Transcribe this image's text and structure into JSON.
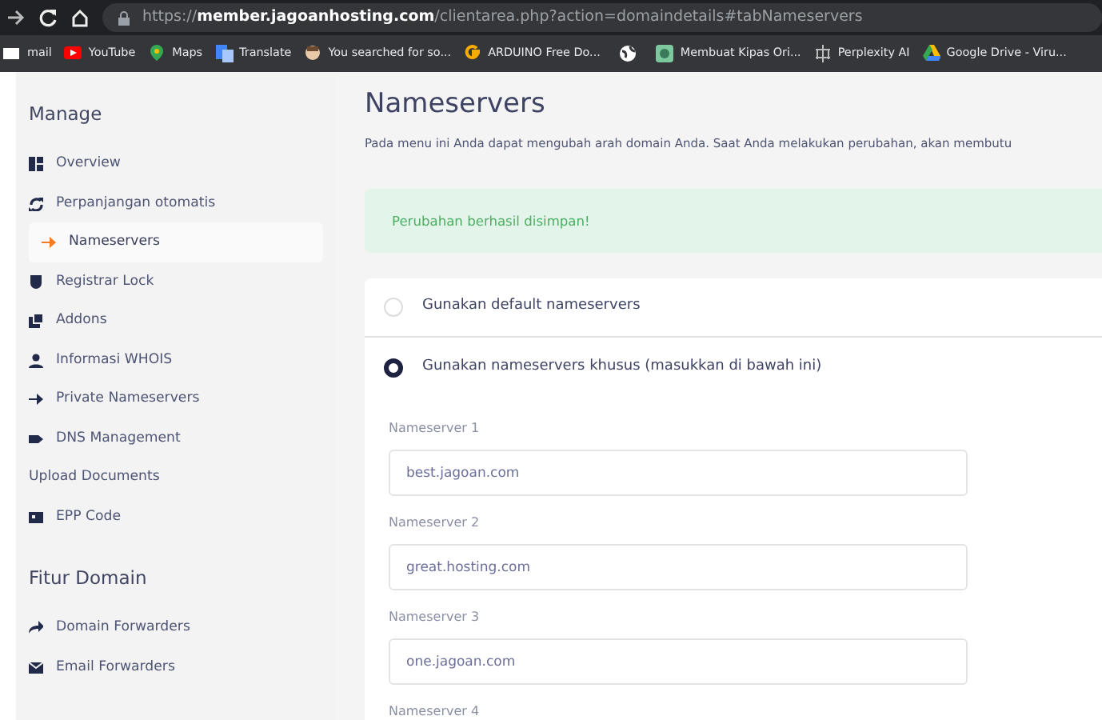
{
  "browser": {
    "url": "https://**member.jagoanhosting.com**/clientarea.php?action=domaindetails#tabNameservers",
    "bookmarks": [
      {
        "kind": "link",
        "label": "mail"
      },
      {
        "kind": "link",
        "label": "YouTube"
      },
      {
        "kind": "link",
        "label": "Maps"
      },
      {
        "kind": "link",
        "label": "Translate"
      },
      {
        "kind": "link",
        "label": "You searched for so..."
      },
      {
        "kind": "link",
        "label": "ARDUINO Free Do..."
      },
      {
        "kind": "icon-only"
      },
      {
        "kind": "link",
        "label": "Membuat Kipas Ori..."
      },
      {
        "kind": "link",
        "label": "Perplexity AI"
      },
      {
        "kind": "link",
        "label": "Google Drive - Viru..."
      }
    ]
  },
  "sidebar": {
    "sections": [
      {
        "title": "Manage",
        "items": [
          {
            "label": "Overview",
            "selected": false
          },
          {
            "label": "Perpanjangan otomatis",
            "selected": false
          },
          {
            "label": "Nameservers",
            "selected": true
          },
          {
            "label": "Registrar Lock",
            "selected": false
          },
          {
            "label": "Addons",
            "selected": false
          },
          {
            "label": "Informasi WHOIS",
            "selected": false
          },
          {
            "label": "Private Nameservers",
            "selected": false
          },
          {
            "label": "DNS Management",
            "selected": false
          },
          {
            "label": "Upload Documents",
            "selected": false
          },
          {
            "label": "EPP Code",
            "selected": false
          }
        ]
      },
      {
        "title": "Fitur Domain",
        "items": [
          {
            "label": "Domain Forwarders",
            "selected": false
          },
          {
            "label": "Email Forwarders",
            "selected": false
          }
        ]
      }
    ]
  },
  "page": {
    "title": "Nameservers",
    "description": "Pada menu ini Anda dapat mengubah arah domain Anda. Saat Anda melakukan perubahan, akan membutu",
    "alert": "Perubahan berhasil disimpan!",
    "options": [
      {
        "label": "Gunakan default nameservers",
        "selected": false
      },
      {
        "label": "Gunakan nameservers khusus (masukkan di bawah ini)",
        "selected": true
      }
    ],
    "nameservers": [
      {
        "label": "Nameserver 1",
        "value": "best.jagoan.com"
      },
      {
        "label": "Nameserver 2",
        "value": "great.hosting.com"
      },
      {
        "label": "Nameserver 3",
        "value": "one.jagoan.com"
      },
      {
        "label": "Nameserver 4"
      }
    ]
  }
}
